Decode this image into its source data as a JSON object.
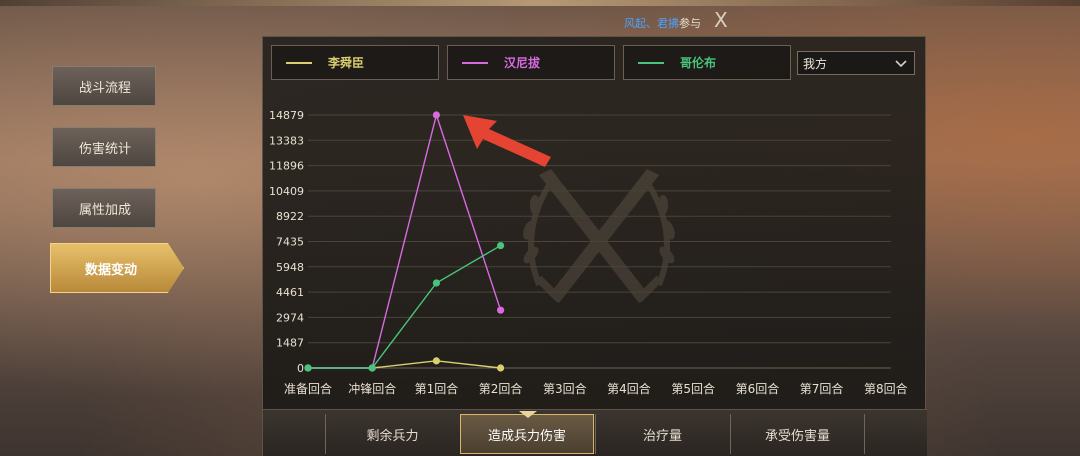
{
  "header": {
    "tip_highlight": "风起、君拂",
    "tip_rest": "参与",
    "close_label": "X"
  },
  "sidebar": {
    "items": [
      {
        "label": "战斗流程",
        "active": false
      },
      {
        "label": "伤害统计",
        "active": false
      },
      {
        "label": "属性加成",
        "active": false
      },
      {
        "label": "数据变动",
        "active": true
      }
    ]
  },
  "legend": [
    {
      "name": "李舜臣",
      "color": "#d9cf6e"
    },
    {
      "name": "汉尼拔",
      "color": "#d86ae0"
    },
    {
      "name": "哥伦布",
      "color": "#48c47c"
    }
  ],
  "side_select": {
    "value": "我方"
  },
  "tabs": [
    {
      "label": "剩余兵力",
      "active": false
    },
    {
      "label": "造成兵力伤害",
      "active": true
    },
    {
      "label": "治疗量",
      "active": false
    },
    {
      "label": "承受伤害量",
      "active": false
    }
  ],
  "icons": {
    "close": "close-icon",
    "dropdown": "chevron-down-icon",
    "emblem": "crossed-swords-laurel-icon",
    "pointer": "red-arrow-icon"
  },
  "chart_data": {
    "type": "line",
    "categories": [
      "准备回合",
      "冲锋回合",
      "第1回合",
      "第2回合",
      "第3回合",
      "第4回合",
      "第5回合",
      "第6回合",
      "第7回合",
      "第8回合"
    ],
    "y_ticks": [
      "0",
      "1487",
      "2974",
      "4461",
      "5948",
      "7435",
      "8922",
      "10409",
      "11896",
      "13383",
      "14879"
    ],
    "ylim": [
      0,
      14879
    ],
    "grid": true,
    "series": [
      {
        "name": "李舜臣",
        "color": "#d9cf6e",
        "values": [
          0,
          0,
          420,
          0
        ]
      },
      {
        "name": "汉尼拔",
        "color": "#d86ae0",
        "values": [
          0,
          0,
          14879,
          3400
        ]
      },
      {
        "name": "哥伦布",
        "color": "#48c47c",
        "values": [
          0,
          0,
          5000,
          7200
        ]
      }
    ]
  }
}
